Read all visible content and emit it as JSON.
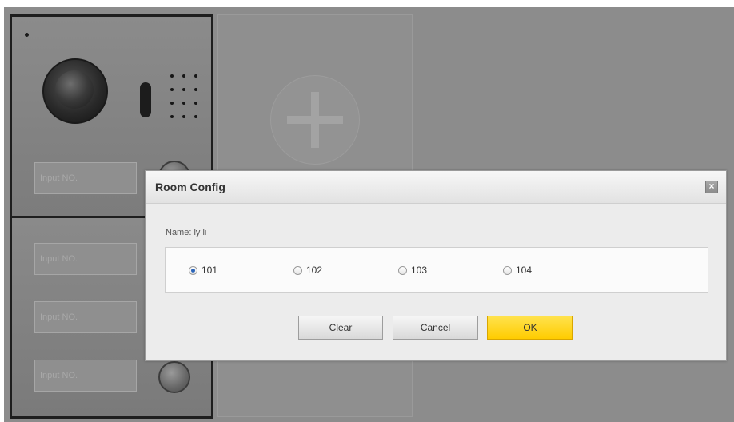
{
  "door_station": {
    "input_placeholder": "Input NO."
  },
  "dialog": {
    "title": "Room Config",
    "close_symbol": "×",
    "name_text": "Name: ly li",
    "rooms": [
      {
        "label": "101",
        "checked": true
      },
      {
        "label": "102",
        "checked": false
      },
      {
        "label": "103",
        "checked": false
      },
      {
        "label": "104",
        "checked": false
      }
    ],
    "buttons": {
      "clear": "Clear",
      "cancel": "Cancel",
      "ok": "OK"
    }
  },
  "colors": {
    "ok_accent": "#ffcc00",
    "radio_selected": "#2a64b8",
    "background": "#8c8c8c"
  },
  "icons": {
    "add_module": "plus-icon",
    "close": "close-icon",
    "camera": "camera-icon",
    "speaker": "speaker-grille-icon",
    "call": "call-button-icon"
  }
}
